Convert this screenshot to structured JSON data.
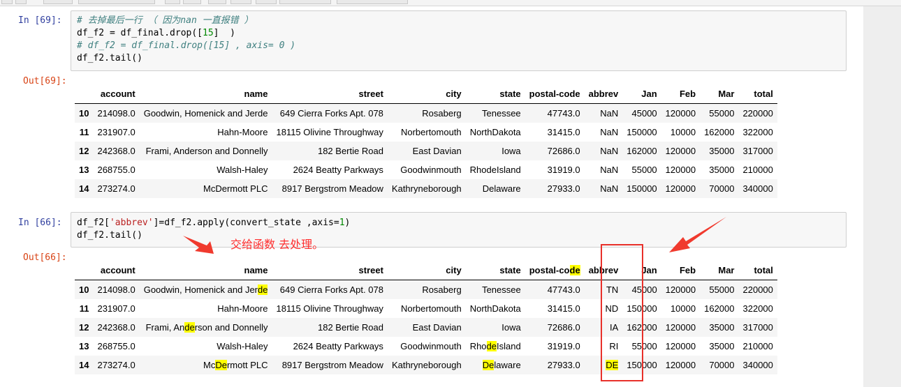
{
  "cells": [
    {
      "in_prompt": "In [69]:",
      "out_prompt": "Out[69]:",
      "code_lines": [
        [
          {
            "t": "# 去掉最后一行 （ 因为nan 一直报错 ）",
            "c": "cm"
          }
        ],
        [
          {
            "t": "df_f2 = df_final.drop([",
            "c": ""
          },
          {
            "t": "15",
            "c": "num"
          },
          {
            "t": "]  )",
            "c": ""
          }
        ],
        [
          {
            "t": "# df_f2 = df_final.drop([15] , axis= 0 )",
            "c": "cm"
          }
        ],
        [
          {
            "t": "df_f2.tail()",
            "c": ""
          }
        ]
      ],
      "table": {
        "columns": [
          "",
          "account",
          "name",
          "street",
          "city",
          "state",
          "postal-code",
          "abbrev",
          "Jan",
          "Feb",
          "Mar",
          "total"
        ],
        "rows": [
          [
            "10",
            "214098.0",
            "Goodwin, Homenick and Jerde",
            "649 Cierra Forks Apt. 078",
            "Rosaberg",
            "Tenessee",
            "47743.0",
            "NaN",
            "45000",
            "120000",
            "55000",
            "220000"
          ],
          [
            "11",
            "231907.0",
            "Hahn-Moore",
            "18115 Olivine Throughway",
            "Norbertomouth",
            "NorthDakota",
            "31415.0",
            "NaN",
            "150000",
            "10000",
            "162000",
            "322000"
          ],
          [
            "12",
            "242368.0",
            "Frami, Anderson and Donnelly",
            "182 Bertie Road",
            "East Davian",
            "Iowa",
            "72686.0",
            "NaN",
            "162000",
            "120000",
            "35000",
            "317000"
          ],
          [
            "13",
            "268755.0",
            "Walsh-Haley",
            "2624 Beatty Parkways",
            "Goodwinmouth",
            "RhodeIsland",
            "31919.0",
            "NaN",
            "55000",
            "120000",
            "35000",
            "210000"
          ],
          [
            "14",
            "273274.0",
            "McDermott PLC",
            "8917 Bergstrom Meadow",
            "Kathryneborough",
            "Delaware",
            "27933.0",
            "NaN",
            "150000",
            "120000",
            "70000",
            "340000"
          ]
        ]
      }
    },
    {
      "in_prompt": "In [66]:",
      "out_prompt": "Out[66]:",
      "code_lines": [
        [
          {
            "t": "df_f2[",
            "c": ""
          },
          {
            "t": "'abbrev'",
            "c": "str"
          },
          {
            "t": "]=df_f2.apply(convert_state ,axis=",
            "c": ""
          },
          {
            "t": "1",
            "c": "num"
          },
          {
            "t": ")",
            "c": ""
          }
        ],
        [
          {
            "t": "df_f2.tail()",
            "c": ""
          }
        ]
      ],
      "annotation": "交给函数  去处理。",
      "table": {
        "columns": [
          "",
          "account",
          "name",
          "street",
          "city",
          "state",
          "postal-co|de",
          "abbrev",
          "Jan",
          "Feb",
          "Mar",
          "total"
        ],
        "rows": [
          [
            "10",
            "214098.0",
            "Goodwin, Homenick and Jer|de",
            "649 Cierra Forks Apt. 078",
            "Rosaberg",
            "Tenessee",
            "47743.0",
            "TN",
            "45000",
            "120000",
            "55000",
            "220000"
          ],
          [
            "11",
            "231907.0",
            "Hahn-Moore",
            "18115 Olivine Throughway",
            "Norbertomouth",
            "NorthDakota",
            "31415.0",
            "ND",
            "150000",
            "10000",
            "162000",
            "322000"
          ],
          [
            "12",
            "242368.0",
            "Frami, An|de|rson and Donnelly",
            "182 Bertie Road",
            "East Davian",
            "Iowa",
            "72686.0",
            "IA",
            "162000",
            "120000",
            "35000",
            "317000"
          ],
          [
            "13",
            "268755.0",
            "Walsh-Haley",
            "2624 Beatty Parkways",
            "Goodwinmouth",
            "Rho|de|Island",
            "31919.0",
            "RI",
            "55000",
            "120000",
            "35000",
            "210000"
          ],
          [
            "14",
            "273274.0",
            "Mc|De|rmott PLC",
            "8917 Bergstrom Meadow",
            "Kathryneborough",
            "|De|laware",
            "27933.0",
            "|DE|",
            "150000",
            "120000",
            "70000",
            "340000"
          ]
        ]
      }
    }
  ],
  "colors": {
    "annotation": "#ff2d2d",
    "highlight": "#ffff00",
    "in_prompt": "#303f9f",
    "out_prompt": "#d84315"
  }
}
